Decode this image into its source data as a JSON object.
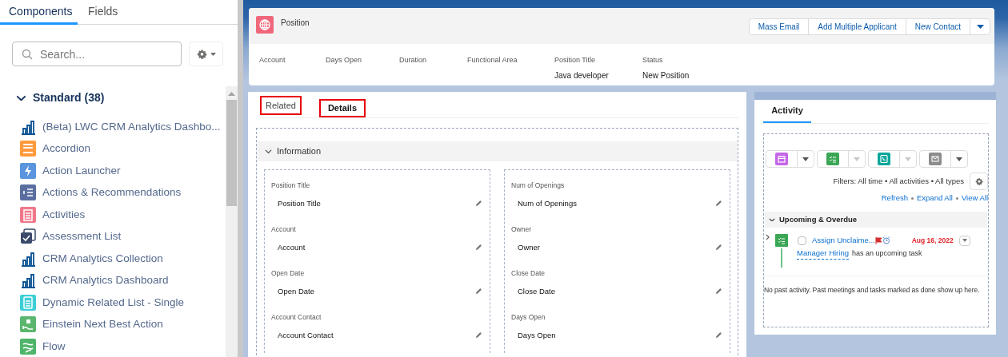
{
  "sidebar": {
    "tabs": [
      {
        "label": "Components",
        "selected": true
      },
      {
        "label": "Fields",
        "selected": false
      }
    ],
    "search": {
      "placeholder": "Search..."
    },
    "section": {
      "title": "Standard (38)",
      "expanded": true,
      "items": [
        {
          "label": "(Beta) LWC CRM Analytics Dashbo...",
          "kind": "chart",
          "color": "#0b5394"
        },
        {
          "label": "Accordion",
          "kind": "accordion",
          "color": "#ff9a3c"
        },
        {
          "label": "Action Launcher",
          "kind": "bolt",
          "color": "#5a95dd"
        },
        {
          "label": "Actions & Recommendations",
          "kind": "list",
          "color": "#5a6fa0"
        },
        {
          "label": "Activities",
          "kind": "clipboard",
          "color": "#f0788a"
        },
        {
          "label": "Assessment List",
          "kind": "stack",
          "color": "#3b4a6b"
        },
        {
          "label": "CRM Analytics Collection",
          "kind": "chart",
          "color": "#0b5394"
        },
        {
          "label": "CRM Analytics Dashboard",
          "kind": "chart",
          "color": "#0b5394"
        },
        {
          "label": "Dynamic Related List - Single",
          "kind": "doc",
          "color": "#3ecfd6"
        },
        {
          "label": "Einstein Next Best Action",
          "kind": "hand",
          "color": "#5bb66e"
        },
        {
          "label": "Flow",
          "kind": "flow",
          "color": "#4fb56a"
        }
      ]
    }
  },
  "record_header": {
    "object": "Position",
    "actions": [
      "Mass Email",
      "Add Multiple Applicant",
      "New Contact"
    ],
    "fields": [
      {
        "label": "Account"
      },
      {
        "label": "Days Open"
      },
      {
        "label": "Duration"
      },
      {
        "label": "Functional Area"
      },
      {
        "label": "Position Title",
        "value": "Java developer"
      },
      {
        "label": "Status",
        "value": "New Position"
      }
    ]
  },
  "main_tabs": [
    {
      "label": "Related",
      "selected": false
    },
    {
      "label": "Details",
      "selected": true
    }
  ],
  "information": {
    "title": "Information",
    "expanded": true,
    "columns": [
      [
        {
          "label": "Position Title",
          "value": "Position Title"
        },
        {
          "label": "Account",
          "value": "Account"
        },
        {
          "label": "Open Date",
          "value": "Open Date"
        },
        {
          "label": "Account Contact",
          "value": "Account Contact"
        }
      ],
      [
        {
          "label": "Num of Openings",
          "value": "Num of Openings"
        },
        {
          "label": "Owner",
          "value": "Owner"
        },
        {
          "label": "Close Date",
          "value": "Close Date"
        },
        {
          "label": "Days Open",
          "value": "Days Open"
        }
      ]
    ]
  },
  "activity": {
    "tabs": [
      {
        "label": "Activity",
        "selected": true
      }
    ],
    "composer": [
      {
        "kind": "event",
        "color": "#c466e8",
        "disabled": false
      },
      {
        "kind": "task",
        "color": "#3ba755",
        "disabled": true
      },
      {
        "kind": "call",
        "color": "#0ba79a",
        "disabled": true
      },
      {
        "kind": "email",
        "color": "#8c8c8c",
        "disabled": false
      }
    ],
    "filters": "Filters: All time • All activities • All types",
    "links": [
      "Refresh",
      "Expand All",
      "View All"
    ],
    "upcoming": {
      "title": "Upcoming & Overdue",
      "expanded": true,
      "tasks": [
        {
          "subject": "Assign Unclaime...",
          "date": "Aug 16, 2022",
          "checked": false,
          "who": "Manager Hiring",
          "note": "has an upcoming task"
        }
      ]
    },
    "empty_message": "No past activity. Past meetings and tasks marked as done show up here."
  }
}
